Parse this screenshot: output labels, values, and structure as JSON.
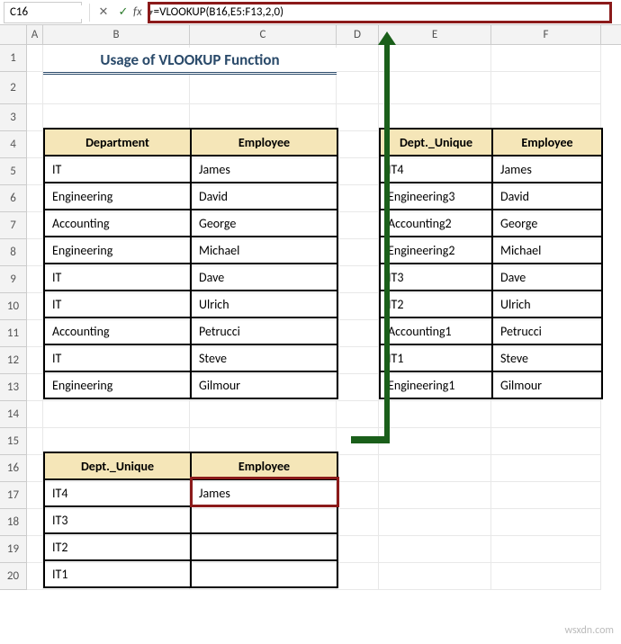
{
  "nameBox": "C16",
  "formula": "=VLOOKUP(B16,E5:F13,2,0)",
  "columns": [
    "A",
    "B",
    "C",
    "D",
    "E",
    "F"
  ],
  "rowNumbers": [
    1,
    2,
    3,
    4,
    5,
    6,
    7,
    8,
    9,
    10,
    11,
    12,
    13,
    14,
    15,
    16,
    17,
    18,
    19,
    20
  ],
  "title": "Usage of VLOOKUP Function",
  "table1": {
    "headers": [
      "Department",
      "Employee"
    ],
    "rows": [
      [
        "IT",
        "James"
      ],
      [
        "Engineering",
        "David"
      ],
      [
        "Accounting",
        "George"
      ],
      [
        "Engineering",
        "Michael"
      ],
      [
        "IT",
        "Dave"
      ],
      [
        "IT",
        "Ulrich"
      ],
      [
        "Accounting",
        "Petrucci"
      ],
      [
        "IT",
        "Steve"
      ],
      [
        "Engineering",
        "Gilmour"
      ]
    ]
  },
  "table2": {
    "headers": [
      "Dept._Unique",
      "Employee"
    ],
    "rows": [
      [
        "IT4",
        "James"
      ],
      [
        "Engineering3",
        "David"
      ],
      [
        "Accounting2",
        "George"
      ],
      [
        "Engineering2",
        "Michael"
      ],
      [
        "IT3",
        "Dave"
      ],
      [
        "IT2",
        "Ulrich"
      ],
      [
        "Accounting1",
        "Petrucci"
      ],
      [
        "IT1",
        "Steve"
      ],
      [
        "Engineering1",
        "Gilmour"
      ]
    ]
  },
  "table3": {
    "headers": [
      "Dept._Unique",
      "Employee"
    ],
    "rows": [
      [
        "IT4",
        "James"
      ],
      [
        "IT3",
        ""
      ],
      [
        "IT2",
        ""
      ],
      [
        "IT1",
        ""
      ]
    ]
  },
  "watermark": "wsxdn.com",
  "icons": {
    "dropdown": "▾",
    "cancel": "✕",
    "confirm": "✓",
    "fx": "fx"
  }
}
